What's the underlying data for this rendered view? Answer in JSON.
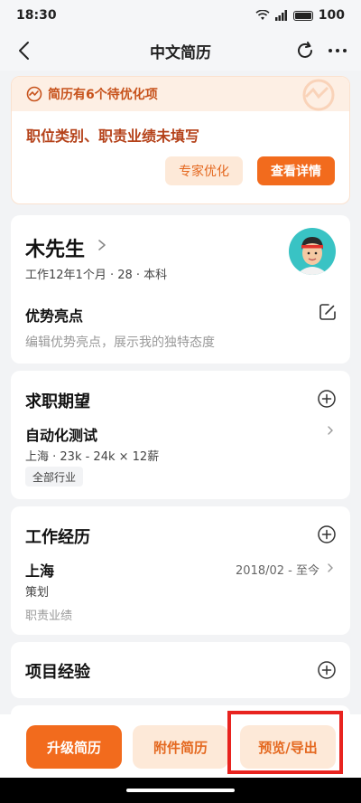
{
  "status": {
    "time": "18:30",
    "battery": "100"
  },
  "nav": {
    "title": "中文简历"
  },
  "optimize": {
    "header": "简历有6个待优化项",
    "warning": "职位类别、职责业绩未填写",
    "expert_btn": "专家优化",
    "detail_btn": "查看详情"
  },
  "profile": {
    "name": "木先生",
    "meta": "工作12年1个月 · 28 · 本科",
    "strength_title": "优势亮点",
    "strength_placeholder": "编辑优势亮点，展示我的独特态度"
  },
  "expect": {
    "title": "求职期望",
    "job": "自动化测试",
    "detail": "上海 · 23k - 24k × 12薪",
    "tag": "全部行业"
  },
  "work": {
    "title": "工作经历",
    "city": "上海",
    "date": "2018/02 - 至今",
    "role": "策划",
    "duty": "职责业绩"
  },
  "project": {
    "title": "项目经验"
  },
  "bottom": {
    "upgrade": "升级简历",
    "attach": "附件简历",
    "preview": "预览/导出"
  },
  "colors": {
    "accent": "#f26b1d",
    "accent_light": "#fde9d8",
    "highlight": "#e8231f"
  }
}
